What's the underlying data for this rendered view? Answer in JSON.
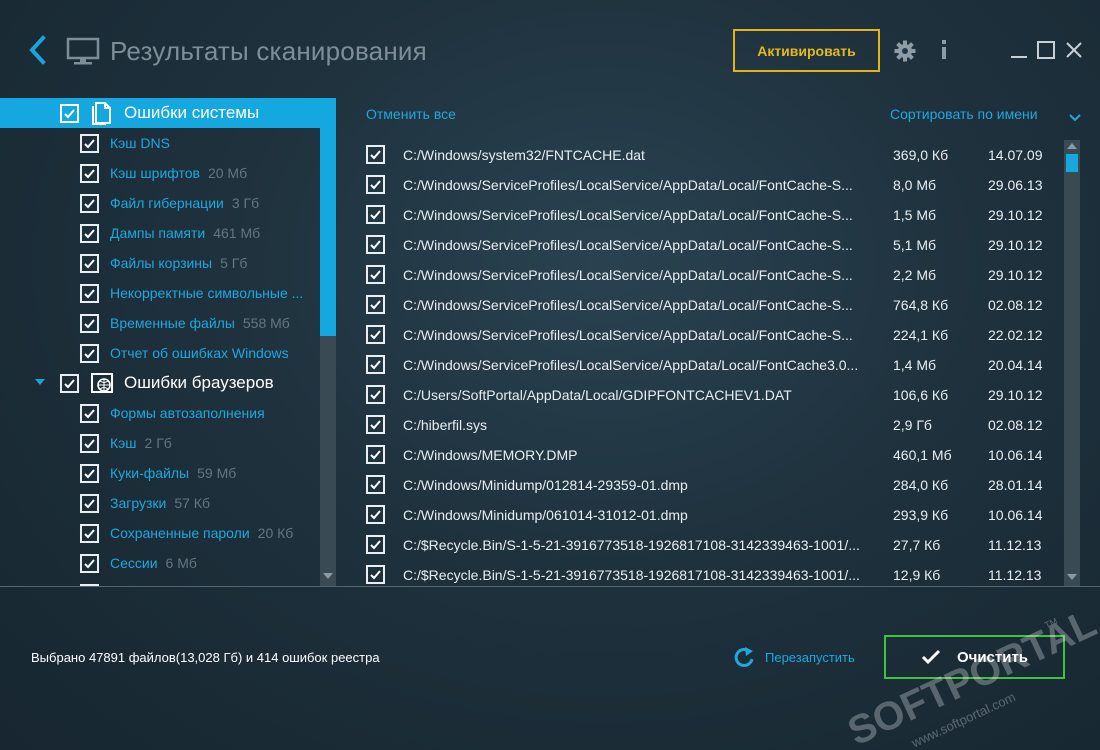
{
  "header": {
    "title": "Результаты сканирования",
    "activate_label": "Активировать",
    "icons": {
      "back": "chevron-left-icon",
      "monitor": "monitor-icon",
      "settings": "gear-icon",
      "info": "info-icon",
      "minimize": "minimize-icon",
      "maximize": "maximize-icon",
      "close": "close-icon"
    },
    "colors": {
      "accent": "#15a7e0",
      "activate": "#e2b415"
    }
  },
  "tree": {
    "categories": [
      {
        "label": "Ошибки системы",
        "icon": "document-icon",
        "checked": true,
        "expanded": true,
        "selected": true,
        "items": [
          {
            "label": "Кэш DNS",
            "size": "",
            "checked": true
          },
          {
            "label": "Кэш шрифтов",
            "size": "20 Мб",
            "checked": true
          },
          {
            "label": "Файл гибернации",
            "size": "3 Гб",
            "checked": true
          },
          {
            "label": "Дампы памяти",
            "size": "461 Мб",
            "checked": true
          },
          {
            "label": "Файлы корзины",
            "size": "5 Гб",
            "checked": true
          },
          {
            "label": "Некорректные символьные ...",
            "size": "",
            "checked": true
          },
          {
            "label": "Временные файлы",
            "size": "558 Мб",
            "checked": true
          },
          {
            "label": "Отчет об ошибках Windows",
            "size": "",
            "checked": true
          }
        ]
      },
      {
        "label": "Ошибки браузеров",
        "icon": "browser-globe-icon",
        "checked": true,
        "expanded": true,
        "selected": false,
        "items": [
          {
            "label": "Формы автозаполнения",
            "size": "",
            "checked": true
          },
          {
            "label": "Кэш",
            "size": "2 Гб",
            "checked": true
          },
          {
            "label": "Куки-файлы",
            "size": "59 Мб",
            "checked": true
          },
          {
            "label": "Загрузки",
            "size": "57 Кб",
            "checked": true
          },
          {
            "label": "Сохраненные пароли",
            "size": "20 Кб",
            "checked": true
          },
          {
            "label": "Сессии",
            "size": "6 Мб",
            "checked": true
          }
        ]
      }
    ]
  },
  "list": {
    "cancel_all_label": "Отменить все",
    "sort_label": "Сортировать по имени",
    "files": [
      {
        "path": "C:/Windows/system32/FNTCACHE.dat",
        "size": "369,0 Кб",
        "date": "14.07.09",
        "checked": true
      },
      {
        "path": "C:/Windows/ServiceProfiles/LocalService/AppData/Local/FontCache-S...",
        "size": "8,0 Мб",
        "date": "29.06.13",
        "checked": true
      },
      {
        "path": "C:/Windows/ServiceProfiles/LocalService/AppData/Local/FontCache-S...",
        "size": "1,5 Мб",
        "date": "29.10.12",
        "checked": true
      },
      {
        "path": "C:/Windows/ServiceProfiles/LocalService/AppData/Local/FontCache-S...",
        "size": "5,1 Мб",
        "date": "29.10.12",
        "checked": true
      },
      {
        "path": "C:/Windows/ServiceProfiles/LocalService/AppData/Local/FontCache-S...",
        "size": "2,2 Мб",
        "date": "29.10.12",
        "checked": true
      },
      {
        "path": "C:/Windows/ServiceProfiles/LocalService/AppData/Local/FontCache-S...",
        "size": "764,8 Кб",
        "date": "02.08.12",
        "checked": true
      },
      {
        "path": "C:/Windows/ServiceProfiles/LocalService/AppData/Local/FontCache-S...",
        "size": "224,1 Кб",
        "date": "22.02.12",
        "checked": true
      },
      {
        "path": "C:/Windows/ServiceProfiles/LocalService/AppData/Local/FontCache3.0...",
        "size": "1,4 Мб",
        "date": "20.04.14",
        "checked": true
      },
      {
        "path": "C:/Users/SoftPortal/AppData/Local/GDIPFONTCACHEV1.DAT",
        "size": "106,6 Кб",
        "date": "29.10.12",
        "checked": true
      },
      {
        "path": "C:/hiberfil.sys",
        "size": "2,9 Гб",
        "date": "02.08.12",
        "checked": true
      },
      {
        "path": "C:/Windows/MEMORY.DMP",
        "size": "460,1 Мб",
        "date": "10.06.14",
        "checked": true
      },
      {
        "path": "C:/Windows/Minidump/012814-29359-01.dmp",
        "size": "284,0 Кб",
        "date": "28.01.14",
        "checked": true
      },
      {
        "path": "C:/Windows/Minidump/061014-31012-01.dmp",
        "size": "293,9 Кб",
        "date": "10.06.14",
        "checked": true
      },
      {
        "path": "C:/$Recycle.Bin/S-1-5-21-3916773518-1926817108-3142339463-1001/...",
        "size": "27,7 Кб",
        "date": "11.12.13",
        "checked": true
      },
      {
        "path": "C:/$Recycle.Bin/S-1-5-21-3916773518-1926817108-3142339463-1001/...",
        "size": "12,9 Кб",
        "date": "11.12.13",
        "checked": true
      }
    ]
  },
  "footer": {
    "status": "Выбрано 47891 файлов(13,028 Гб) и 414 ошибок реестра",
    "restart_label": "Перезапустить",
    "clean_label": "Очистить",
    "colors": {
      "clean_border": "#3fc23c"
    }
  },
  "watermark": {
    "brand": "SOFTPORTAL",
    "url": "www.softportal.com",
    "tm": "TM"
  }
}
